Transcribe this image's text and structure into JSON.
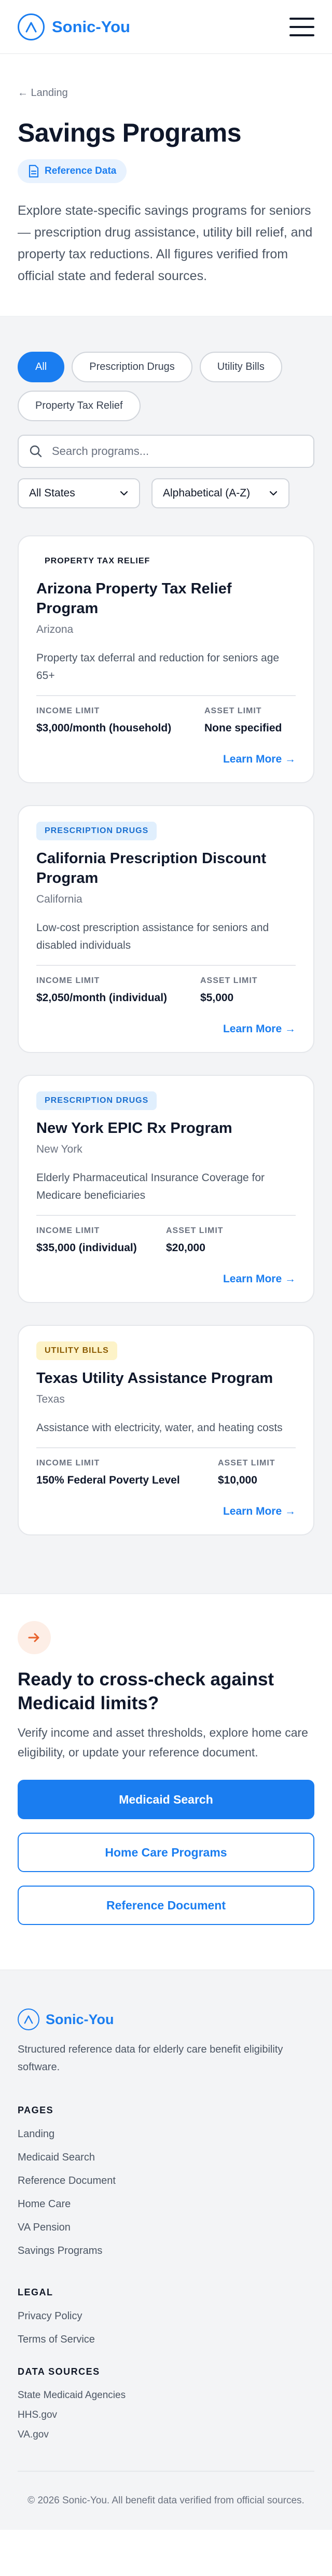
{
  "header": {
    "brand": "Sonic-You"
  },
  "hero": {
    "back": "← Landing",
    "title": "Savings Programs",
    "badge": "Reference Data",
    "description": "Explore state-specific savings programs for seniors — prescription drug assistance, utility bill relief, and property tax reductions. All figures verified from official state and federal sources."
  },
  "filters": {
    "chips": [
      "All",
      "Prescription Drugs",
      "Utility Bills",
      "Property Tax Relief"
    ],
    "active_chip": "All",
    "search_placeholder": "Search programs...",
    "state_select": "All States",
    "sort_select": "Alphabetical (A-Z)"
  },
  "cards": [
    {
      "category": "PROPERTY TAX RELIEF",
      "title": "Arizona Property Tax Relief Program",
      "state": "Arizona",
      "description": "Property tax deferral and reduction for seniors age 65+",
      "income_label": "INCOME LIMIT",
      "income_value": "$3,000/month (household)",
      "asset_label": "ASSET LIMIT",
      "asset_value": "None specified",
      "link": "Learn More →"
    },
    {
      "category": "PRESCRIPTION DRUGS",
      "title": "California Prescription Discount Program",
      "state": "California",
      "description": "Low-cost prescription assistance for seniors and disabled individuals",
      "income_label": "INCOME LIMIT",
      "income_value": "$2,050/month (individual)",
      "asset_label": "ASSET LIMIT",
      "asset_value": "$5,000",
      "link": "Learn More →"
    },
    {
      "category": "PRESCRIPTION DRUGS",
      "title": "New York EPIC Rx Program",
      "state": "New York",
      "description": "Elderly Pharmaceutical Insurance Coverage for Medicare beneficiaries",
      "income_label": "INCOME LIMIT",
      "income_value": "$35,000 (individual)",
      "asset_label": "ASSET LIMIT",
      "asset_value": "$20,000",
      "link": "Learn More →"
    },
    {
      "category": "UTILITY BILLS",
      "title": "Texas Utility Assistance Program",
      "state": "Texas",
      "description": "Assistance with electricity, water, and heating costs",
      "income_label": "INCOME LIMIT",
      "income_value": "150% Federal Poverty Level",
      "asset_label": "ASSET LIMIT",
      "asset_value": "$10,000",
      "link": "Learn More →"
    }
  ],
  "badge_colors": {
    "PROPERTY TAX RELIEF": {
      "bg": "#ffffff",
      "fg": "#111827"
    },
    "PRESCRIPTION DRUGS": {
      "bg": "#e0effd",
      "fg": "#1a6fd0"
    },
    "UTILITY BILLS": {
      "bg": "#fdf3c8",
      "fg": "#8a5a00"
    }
  },
  "cta": {
    "icon": "arrow-right-icon",
    "title": "Ready to cross-check against Medicaid limits?",
    "description": "Verify income and asset thresholds, explore home care eligibility, or update your reference document.",
    "primary": "Medicaid Search",
    "secondary1": "Home Care Programs",
    "secondary2": "Reference Document"
  },
  "footer": {
    "brand": "Sonic-You",
    "description": "Structured reference data for elderly care benefit eligibility software.",
    "pages_heading": "PAGES",
    "pages": [
      "Landing",
      "Medicaid Search",
      "Reference Document",
      "Home Care",
      "VA Pension",
      "Savings Programs"
    ],
    "legal_heading": "LEGAL",
    "legal": [
      "Privacy Policy",
      "Terms of Service"
    ],
    "sources_heading": "DATA SOURCES",
    "sources": [
      "State Medicaid Agencies",
      "HHS.gov",
      "VA.gov"
    ],
    "copyright": "© 2026 Sonic-You. All benefit data verified from official sources."
  },
  "colors": {
    "accent": "#1a7df0",
    "cta_icon_bg": "#fdeee6",
    "cta_icon_fg": "#e8622c"
  }
}
